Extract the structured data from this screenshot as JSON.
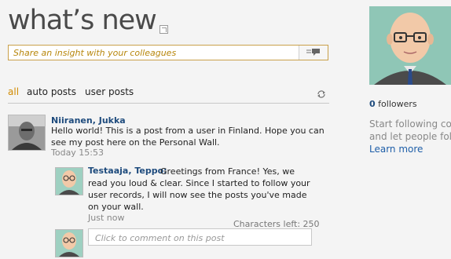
{
  "header": {
    "title": "what’s new"
  },
  "share": {
    "placeholder": "Share an insight with your colleagues"
  },
  "tabs": [
    {
      "label": "all",
      "active": true
    },
    {
      "label": "auto posts",
      "active": false
    },
    {
      "label": "user posts",
      "active": false
    }
  ],
  "post": {
    "author": "Niiranen, Jukka",
    "text": "Hello world! This is a post from a user in Finland. Hope you can see my post here on the Personal Wall.",
    "time": "Today 15:53"
  },
  "reply": {
    "author": "Testaaja, Teppo:",
    "text": "Greetings from France! Yes, we read you loud & clear. Since I started to follow your user records, I will now see the posts you've made on your wall.",
    "time": "Just now"
  },
  "comment": {
    "chars_left": "Characters left: 250",
    "placeholder": "Click to comment on this post"
  },
  "sidebar": {
    "followers_count": "0",
    "followers_label": "followers",
    "suggest_line1": "Start following col",
    "suggest_line2": "and let people foll",
    "learn_more": "Learn more"
  },
  "colors": {
    "accent": "#d08a00",
    "link": "#1e4b7d",
    "background": "#f4f4f4"
  }
}
